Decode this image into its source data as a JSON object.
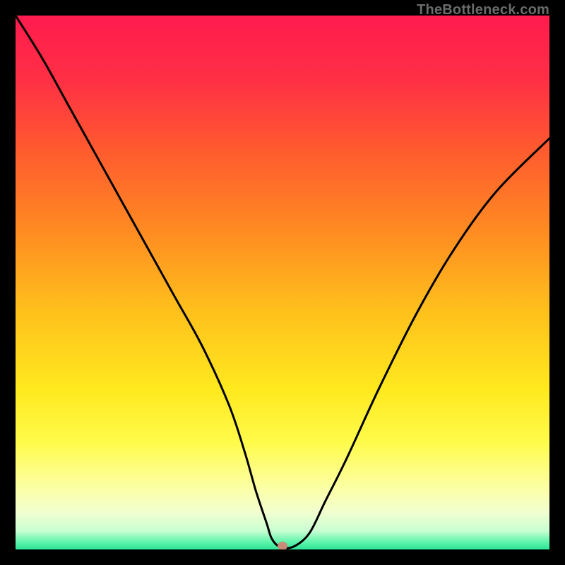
{
  "watermark": "TheBottleneck.com",
  "colors": {
    "frame": "#000000",
    "watermark": "#6b6b6b",
    "curve": "#000000",
    "marker": "#c98a78",
    "gradient_stops": [
      {
        "offset": 0.0,
        "color": "#ff1b4e"
      },
      {
        "offset": 0.12,
        "color": "#ff2f45"
      },
      {
        "offset": 0.25,
        "color": "#ff5a2f"
      },
      {
        "offset": 0.4,
        "color": "#ff8a22"
      },
      {
        "offset": 0.55,
        "color": "#ffbf1c"
      },
      {
        "offset": 0.7,
        "color": "#ffe91e"
      },
      {
        "offset": 0.8,
        "color": "#fffb4b"
      },
      {
        "offset": 0.88,
        "color": "#fcffa0"
      },
      {
        "offset": 0.93,
        "color": "#f2ffd0"
      },
      {
        "offset": 0.965,
        "color": "#c9ffd2"
      },
      {
        "offset": 0.985,
        "color": "#63f5ad"
      },
      {
        "offset": 1.0,
        "color": "#2be698"
      }
    ]
  },
  "chart_data": {
    "type": "line",
    "title": "",
    "xlabel": "",
    "ylabel": "",
    "xlim": [
      0,
      100
    ],
    "ylim": [
      0,
      100
    ],
    "grid": false,
    "legend": false,
    "series": [
      {
        "name": "bottleneck-curve",
        "x": [
          0,
          5,
          10,
          15,
          20,
          25,
          30,
          35,
          40,
          43,
          45,
          47,
          48,
          49.5,
          52,
          55,
          58,
          62,
          68,
          75,
          82,
          90,
          100
        ],
        "y": [
          100,
          92,
          83,
          74,
          65,
          56,
          47,
          38,
          27,
          18,
          11,
          5,
          2,
          0.5,
          0.5,
          3,
          9,
          17,
          30,
          44,
          56,
          67,
          77
        ]
      }
    ],
    "marker": {
      "x": 50,
      "y": 0.7
    }
  }
}
